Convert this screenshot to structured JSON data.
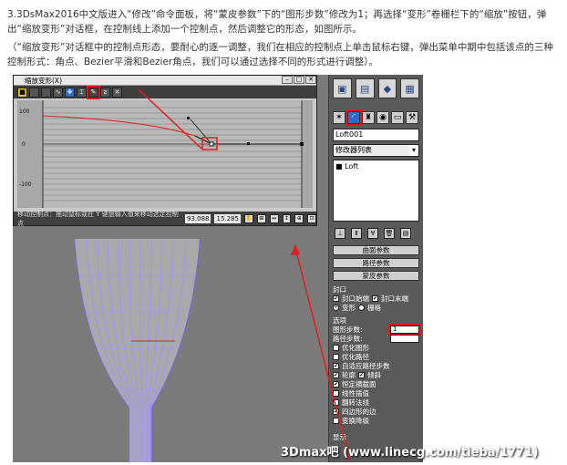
{
  "article": {
    "para1": "3.3DsMax2016中文版进入“修改”命令面板，将“蒙皮参数”下的“图形步数”修改为1；再选择“变形”卷栅栏下的“缩放”按钮，弹出“缩放变形”对话框，在控制线上添加一个控制点，然后调整它的形态，如图所示。",
    "para2": "（“缩放变形”对话框中的控制点形态，要耐心的逐一调整，我们在相应的控制点上单击鼠标右键，弹出菜单中期中包括该点的三种控制形式：角点、Bezier平滑和Bezier角点，我们可以通过选择不同的形式进行调整）。"
  },
  "dialog": {
    "title": "缩放变形(X)",
    "ticks": [
      "100",
      "0",
      "-100"
    ],
    "status_text": "移动控制点：拖动鼠标或在 Y 键盘输入值来移动选定控制点",
    "value_x": "93.088",
    "value_y": "15.285"
  },
  "command_panel": {
    "object_name": "Loft001",
    "modifier_list": "修改器列表",
    "stack_item": "Loft",
    "rollouts": [
      "曲面参数",
      "路径参数",
      "蒙皮参数"
    ],
    "capping_label": "封口",
    "cap_start": "封口始端",
    "cap_end": "封口末端",
    "morph": "变形",
    "grid": "栅格",
    "options_label": "选项",
    "shape_steps_label": "图形步数:",
    "shape_steps_value": "1",
    "path_steps_label": "路径步数:",
    "options": [
      "优化图形",
      "优化路径",
      "自适应路径步数",
      "轮廓",
      "倾斜",
      "恒定横截面",
      "线性插值",
      "翻转法线",
      "四边形的边",
      "变换降级"
    ],
    "bottom_label": "显示"
  },
  "watermark": "3Dmax吧 (www.linecg.com/tieba/1771)",
  "colors": {
    "accent_red": "#e11d1d",
    "selection_blue": "#2e6bcf",
    "mesh_blue": "#6a5cff"
  }
}
